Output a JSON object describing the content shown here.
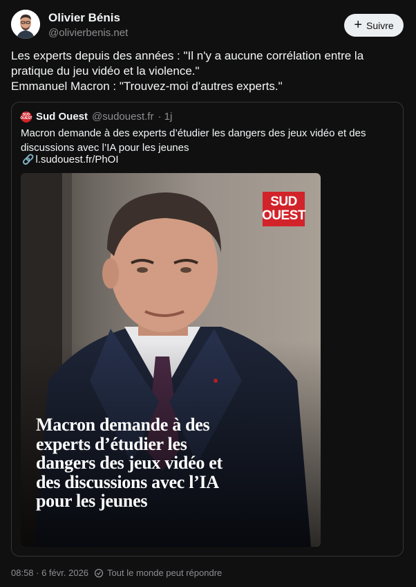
{
  "author": {
    "display_name": "Olivier Bénis",
    "handle": "@olivierbenis.net",
    "avatar_icon": "avatar-photo"
  },
  "follow_button": {
    "label": "Suivre",
    "icon": "plus-icon"
  },
  "post": {
    "lines": [
      "Les experts depuis des années : \"Il n'y a aucune corrélation entre la",
      "pratique du jeu vidéo et la violence.\"",
      "Emmanuel Macron : \"Trouvez-moi d'autres experts.\""
    ]
  },
  "quote": {
    "name": "Sud Ouest",
    "handle": "@sudouest.fr",
    "time": "· 1j",
    "avatar_text_1": "SUD",
    "avatar_text_2": "OUEST",
    "text_lines": [
      "Macron demande à des experts d’étudier les dangers des jeux vidéo et des",
      "discussions avec l’IA pour les jeunes"
    ],
    "link": "l.sudouest.fr/PhOI",
    "image": {
      "logo_line1": "SUD",
      "logo_line2": "OUEST",
      "headline_lines": [
        "Macron demande à des",
        "experts d’étudier les",
        "dangers des jeux vidéo et",
        "des discussions avec l’IA",
        "pour les jeunes"
      ]
    }
  },
  "footer": {
    "timestamp": "08:58 · 6 févr. 2026",
    "reply_setting": "Tout le monde peut répondre"
  },
  "colors": {
    "background": "#101010",
    "text": "#f3f5f7",
    "muted": "#8e8e93",
    "brand_red": "#d2232a",
    "button_bg": "#eceff2"
  }
}
